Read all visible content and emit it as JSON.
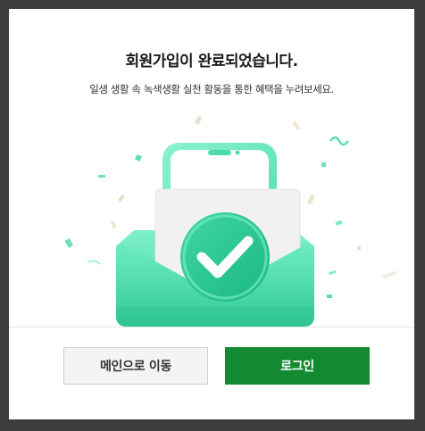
{
  "dialog": {
    "title": "회원가입이 완료되었습니다.",
    "subtitle": "일생 생활 속 녹색생활 실천 활동을 통한 혜택을 누려보세요."
  },
  "buttons": {
    "main_label": "메인으로 이동",
    "login_label": "로그인"
  },
  "illustration": {
    "icon": "check-envelope-phone-icon"
  },
  "colors": {
    "primary_green": "#138a32",
    "mint": "#4fe0b0",
    "secondary_bg": "#f4f4f4",
    "overlay": "#3d3d3d"
  }
}
